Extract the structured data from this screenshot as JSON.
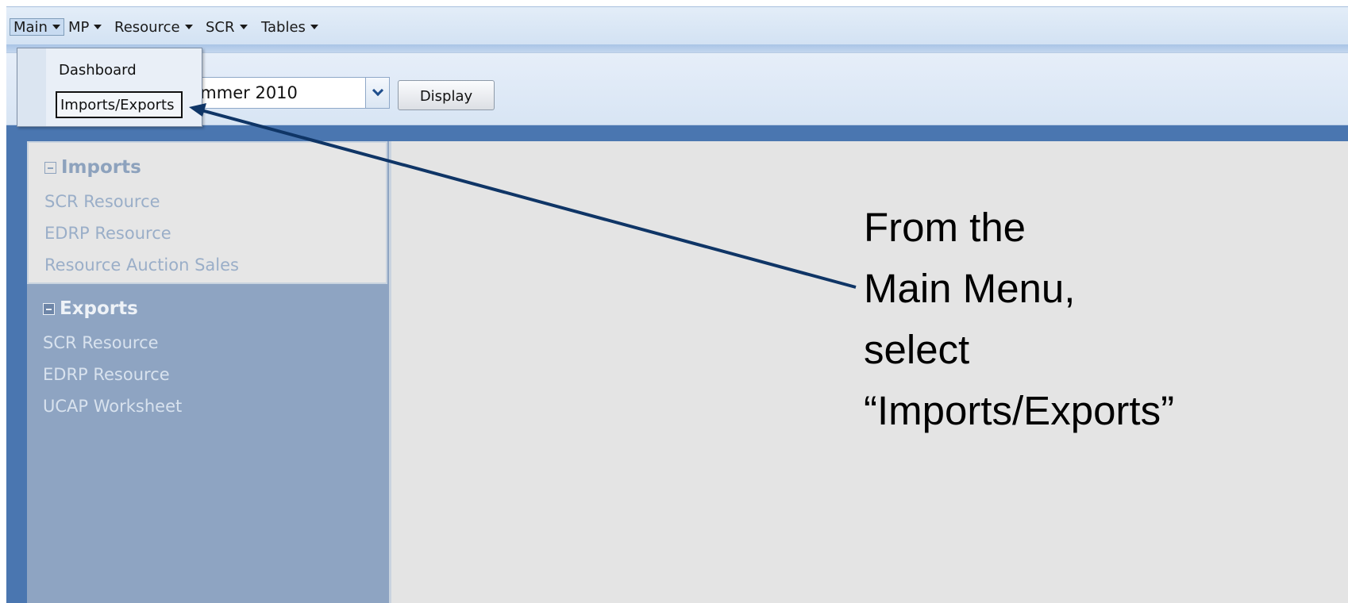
{
  "menubar": {
    "items": [
      {
        "label": "Main",
        "active": true
      },
      {
        "label": "MP"
      },
      {
        "label": "Resource"
      },
      {
        "label": "SCR"
      },
      {
        "label": "Tables"
      }
    ]
  },
  "dropdown": {
    "items": [
      {
        "label": "Dashboard"
      },
      {
        "label": "Imports/Exports",
        "selected": true
      }
    ]
  },
  "toolbar": {
    "season_value": "ummer 2010",
    "display_label": "Display"
  },
  "nav": {
    "imports": {
      "header": "Imports",
      "links": [
        "SCR Resource",
        "EDRP Resource",
        "Resource Auction Sales"
      ]
    },
    "exports": {
      "header": "Exports",
      "links": [
        "SCR Resource",
        "EDRP Resource",
        "UCAP Worksheet"
      ]
    }
  },
  "annotation": {
    "lines": [
      "From the",
      "Main Menu,",
      "select",
      "“Imports/Exports”"
    ]
  },
  "colors": {
    "frame_blue": "#4a76b0",
    "arrow_navy": "#0f3566",
    "content_gray": "#e4e4e4"
  }
}
